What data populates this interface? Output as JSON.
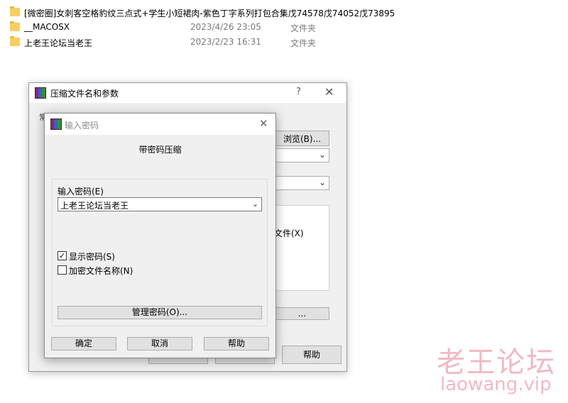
{
  "explorer": {
    "files": [
      {
        "name": "[微密圈]女刺客空格豹纹三点式+学生小短裙肉-紫色丁字系列打包合集戊74578戊74052戊73895",
        "date": "",
        "type": ""
      },
      {
        "name": "__MACOSX",
        "date": "2023/4/26 23:05",
        "type": "文件夹"
      },
      {
        "name": "上老王论坛当老王",
        "date": "2023/2/23 16:31",
        "type": "文件夹"
      }
    ]
  },
  "back_window": {
    "title": "压缩文件名和参数",
    "help_glyph": "?",
    "close_glyph": "✕",
    "tab_partial": "常",
    "browse_button": "浏览(B)...",
    "partial_text": "文件(X)",
    "partial_button": "...",
    "help_button": "帮助"
  },
  "dialog": {
    "title": "输入密码",
    "close_glyph": "✕",
    "subtitle": "带密码压缩",
    "password_label": "输入密码(E)",
    "password_value": "上老王论坛当老王",
    "show_password": {
      "label": "显示密码(S)",
      "checked": true
    },
    "encrypt_names": {
      "label": "加密文件名称(N)",
      "checked": false
    },
    "manage_button": "管理密码(O)...",
    "ok_button": "确定",
    "cancel_button": "取消",
    "help_button": "帮助"
  },
  "watermark": {
    "text": "老王论坛",
    "url": "laowang.vip"
  },
  "icons": {
    "folder": "folder-icon",
    "app": "winrar-icon",
    "dropdown": "chevron-down-icon",
    "check": "checkmark-icon"
  }
}
